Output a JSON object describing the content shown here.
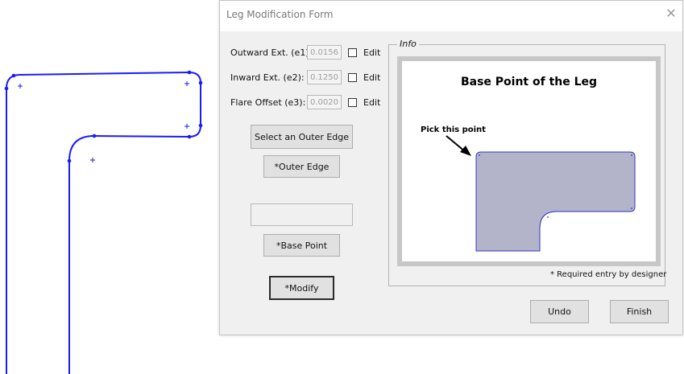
{
  "window": {
    "title": "Leg Modification Form",
    "close_glyph": "✕"
  },
  "fields": [
    {
      "label": "Outward Ext. (e1):",
      "value": "0.0156",
      "edit_label": "Edit"
    },
    {
      "label": "Inward Ext. (e2):",
      "value": "0.1250",
      "edit_label": "Edit"
    },
    {
      "label": "Flare Offset (e3):",
      "value": "0.0020",
      "edit_label": "Edit"
    }
  ],
  "buttons": {
    "select_outer_edge": "Select an Outer Edge",
    "outer_edge": "*Outer Edge",
    "base_point": "*Base Point",
    "modify": "*Modify",
    "undo": "Undo",
    "finish": "Finish"
  },
  "base_point_value": "",
  "info": {
    "legend": "Info",
    "title": "Base Point of the Leg",
    "pick_label": "Pick this point",
    "required_note": "* Required entry by designer"
  },
  "colors": {
    "cad_line": "#1a1aff",
    "shape_fill": "#b3b3c9",
    "shape_stroke": "#3333cc"
  },
  "icons": {
    "close": "close-icon",
    "arrow": "arrow-icon"
  }
}
